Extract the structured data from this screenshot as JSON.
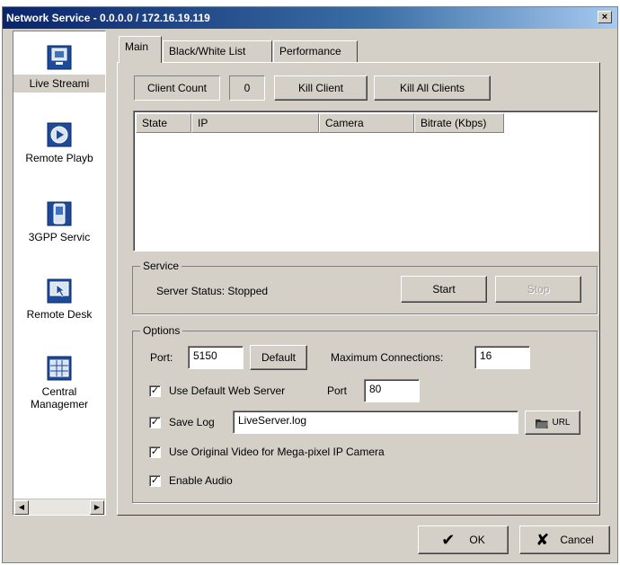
{
  "window": {
    "title": "Network Service - 0.0.0.0 / 172.16.19.119",
    "close_glyph": "×"
  },
  "sidebar": {
    "items": [
      {
        "label": "Live Streami",
        "icon": "monitor-icon"
      },
      {
        "label": "Remote Playb",
        "icon": "playback-icon"
      },
      {
        "label": "3GPP Servic",
        "icon": "mobile-phone-icon"
      },
      {
        "label": "Remote Desk",
        "icon": "remote-desktop-icon"
      },
      {
        "label": "Central",
        "label2": "Managemer",
        "icon": "central-management-icon"
      }
    ],
    "scroll_left": "◀",
    "scroll_right": "▶"
  },
  "tabs": [
    {
      "label": "Main"
    },
    {
      "label": "Black/White List"
    },
    {
      "label": "Performance"
    }
  ],
  "main": {
    "client_count_label": "Client Count",
    "client_count_value": "0",
    "kill_client": "Kill Client",
    "kill_all_clients": "Kill All Clients",
    "table_headers": [
      "State",
      "IP",
      "Camera",
      "Bitrate (Kbps)"
    ]
  },
  "service": {
    "group_title": "Service",
    "status_text": "Server Status: Stopped",
    "start": "Start",
    "stop": "Stop"
  },
  "options": {
    "group_title": "Options",
    "port_label": "Port:",
    "port_value": "5150",
    "default_button": "Default",
    "max_conn_label": "Maximum Connections:",
    "max_conn_value": "16",
    "use_default_web_server": "Use Default Web Server",
    "web_port_label": "Port",
    "web_port_value": "80",
    "save_log": "Save Log",
    "log_file": "LiveServer.log",
    "browse_label": "URL",
    "use_original_video": "Use Original Video for Mega-pixel IP Camera",
    "enable_audio": "Enable Audio",
    "check_glyph": "✓"
  },
  "footer": {
    "ok": "OK",
    "cancel": "Cancel",
    "ok_glyph": "✔",
    "cancel_glyph": "✘"
  },
  "colors": {
    "face": "#d4d0c8",
    "title_start": "#0a246a",
    "title_end": "#a6caf0"
  }
}
